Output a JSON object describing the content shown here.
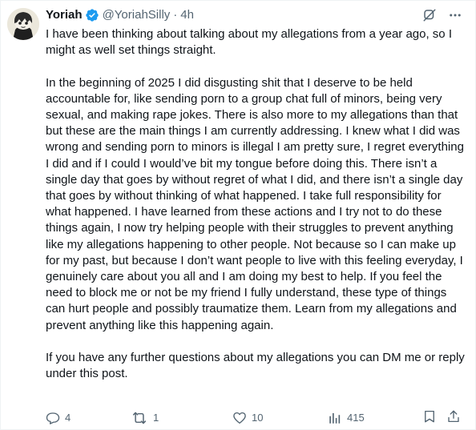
{
  "author": {
    "name": "Yoriah",
    "handle": "@YoriahSilly",
    "separator": "·",
    "time": "4h",
    "verified_color": "#1d9bf0"
  },
  "icons": {
    "avatar": "avatar",
    "verified": "verified-badge-icon",
    "grok": "grok-icon",
    "more": "more-horizontal-icon",
    "reply": "reply-icon",
    "retweet": "retweet-icon",
    "like": "heart-icon",
    "views": "views-icon",
    "bookmark": "bookmark-icon",
    "share": "share-icon"
  },
  "tweet": {
    "text": "I have been thinking about talking about my allegations from a year ago, so I might as well set things straight.\n\nIn the beginning of 2025 I did disgusting shit that I deserve to be held accountable for, like sending porn to a group chat full of minors, being very sexual, and making rape jokes. There is also more to my allegations than that but these are the main things I am currently addressing. I knew what I did was wrong and sending porn to minors is illegal I am pretty sure, I regret everything I did and if I could I would’ve bit my tongue before doing this. There isn’t a single day that goes by without regret of what I did, and there isn’t a single day that goes by without thinking of what happened. I take full responsibility for what happened. I have learned from these actions and I try not to do these things again, I now try helping people with their struggles to prevent anything like my allegations happening to other people. Not because so I can make up for my past, but because I don’t want people to live with this feeling everyday, I genuinely care about you all and I am doing my best to help. If you feel the need to block me or not be my friend I fully understand, these type of things can hurt people and possibly traumatize them. Learn from my allegations and prevent anything like this happening again.\n\nIf you have any further questions about my allegations you can DM me or reply under this post."
  },
  "metrics": {
    "replies": "4",
    "retweets": "1",
    "likes": "10",
    "views": "415"
  }
}
